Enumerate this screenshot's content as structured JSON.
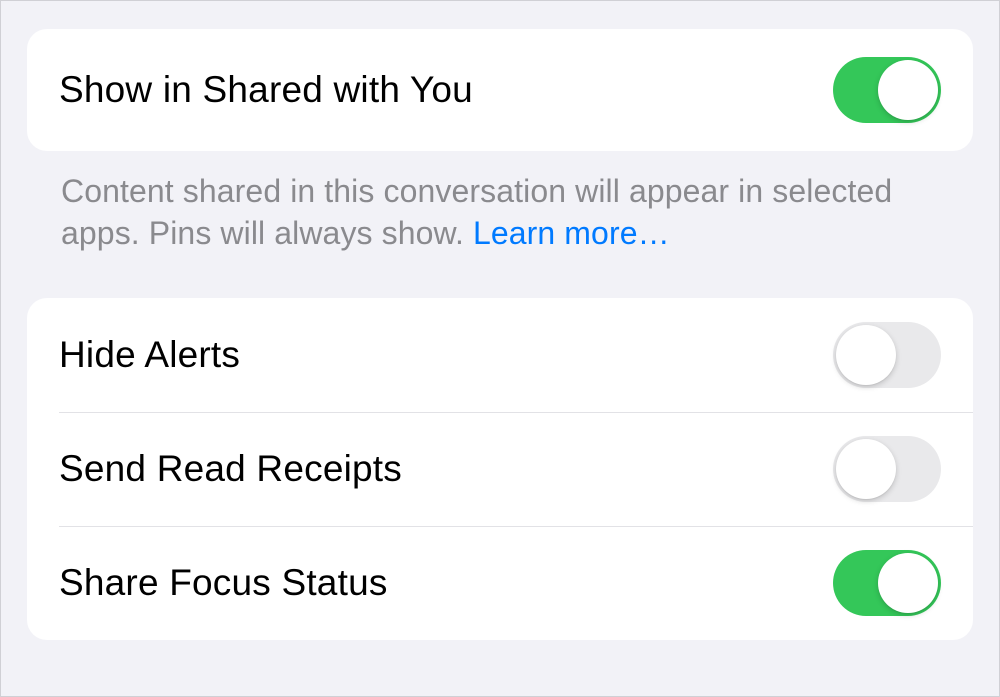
{
  "section1": {
    "rows": [
      {
        "label": "Show in Shared with You",
        "enabled": true
      }
    ],
    "footer": {
      "text": "Content shared in this conversation will appear in selected apps. Pins will always show. ",
      "link": "Learn more…"
    }
  },
  "section2": {
    "rows": [
      {
        "label": "Hide Alerts",
        "enabled": false
      },
      {
        "label": "Send Read Receipts",
        "enabled": false
      },
      {
        "label": "Share Focus Status",
        "enabled": true
      }
    ]
  }
}
